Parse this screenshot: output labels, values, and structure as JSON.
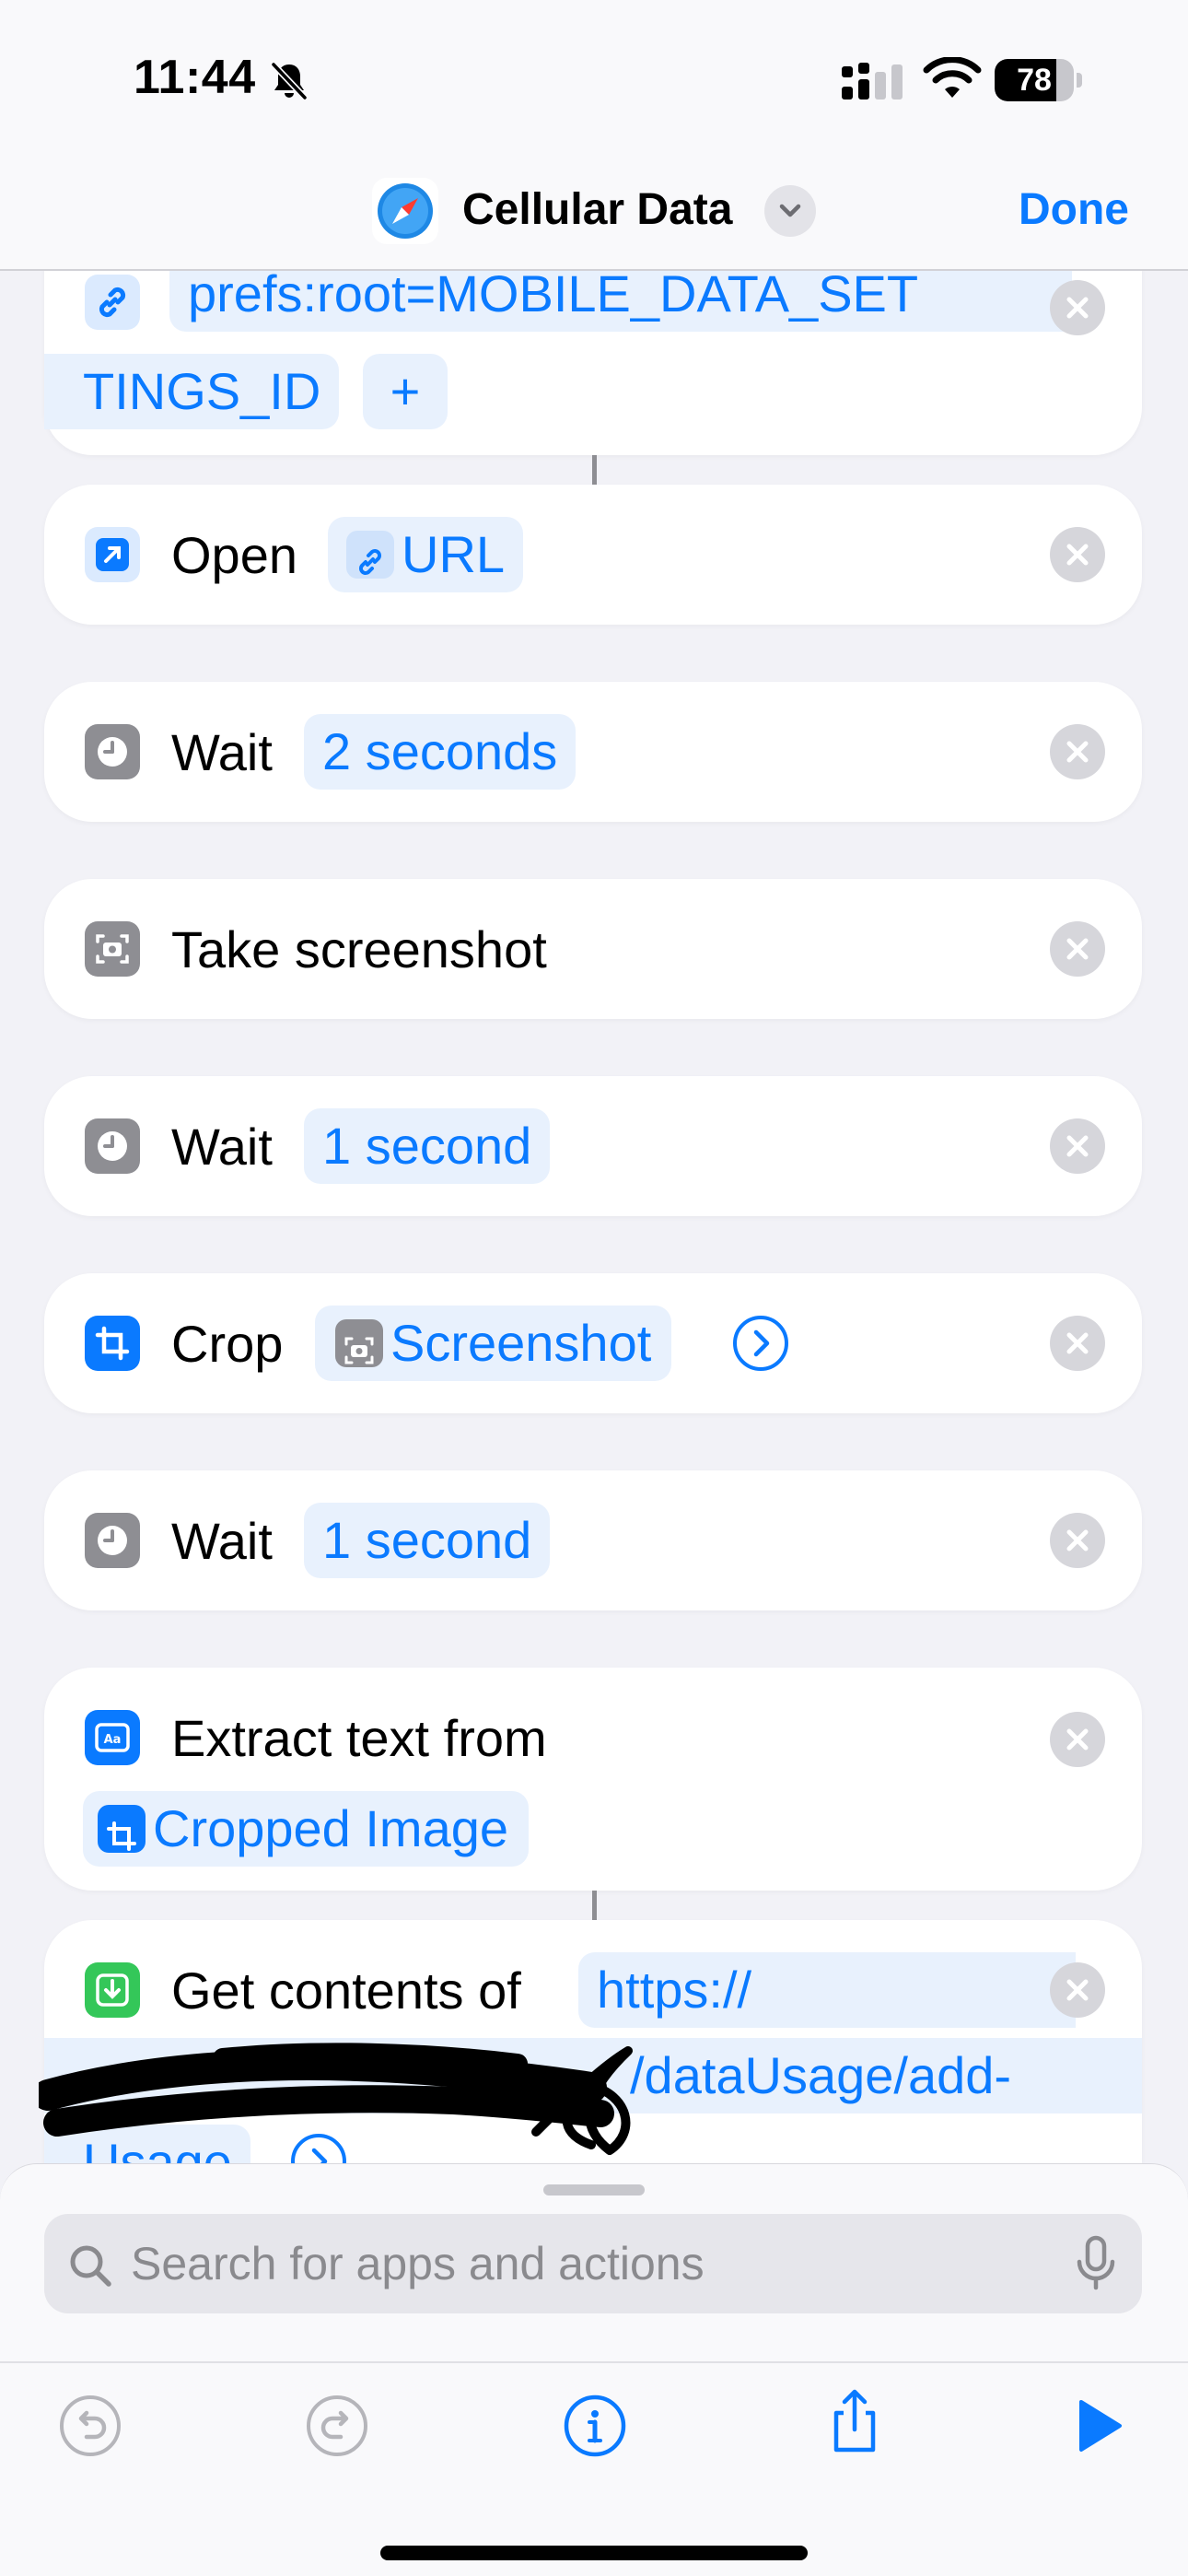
{
  "status_bar": {
    "time": "11:44",
    "battery": "78",
    "battery_level": 0.78
  },
  "nav": {
    "title": "Cellular Data",
    "done_label": "Done"
  },
  "actions": {
    "url": {
      "value_line1": "prefs:root=MOBILE_DATA_SET",
      "value_line2": "TINGS_ID",
      "add_label": "+"
    },
    "open": {
      "verb": "Open",
      "param": "URL"
    },
    "wait_1": {
      "verb": "Wait",
      "param": "2 seconds"
    },
    "screenshot": {
      "verb": "Take screenshot"
    },
    "wait_2": {
      "verb": "Wait",
      "param": "1 second"
    },
    "crop": {
      "verb": "Crop",
      "param": "Screenshot"
    },
    "wait_3": {
      "verb": "Wait",
      "param": "1 second"
    },
    "extract": {
      "verb": "Extract text from",
      "param": "Cropped Image"
    },
    "get_contents": {
      "verb": "Get contents of",
      "url_line1": "https://",
      "url_line2": "/dataUsage/add-",
      "url_line3": "Usage"
    }
  },
  "search": {
    "placeholder": "Search for apps and actions"
  },
  "colors": {
    "accent": "#0a7aff",
    "background": "#f2f2f7",
    "card": "#ffffff",
    "token_bg": "#e8f1fd"
  },
  "icons": [
    "bell-slash-icon",
    "signal-icon",
    "wifi-icon",
    "safari-icon",
    "chevron-down-icon",
    "link-icon",
    "open-app-icon",
    "clock-icon",
    "screenshot-icon",
    "crop-icon",
    "extract-text-icon",
    "download-icon",
    "remove-icon",
    "search-icon",
    "microphone-icon",
    "undo-icon",
    "redo-icon",
    "info-icon",
    "share-icon",
    "play-icon"
  ]
}
